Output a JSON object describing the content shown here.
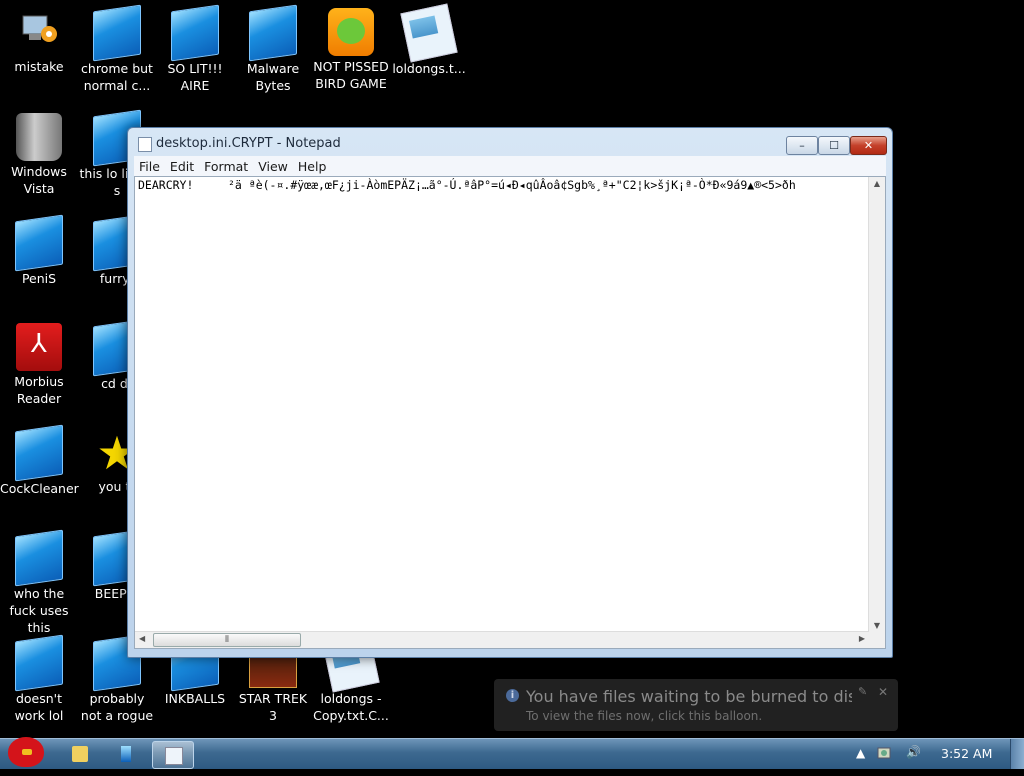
{
  "desktop": {
    "icons": [
      {
        "label": "mistake"
      },
      {
        "label": "chrome but normal c..."
      },
      {
        "label": "SO LIT!!! AIRE"
      },
      {
        "label": "Malware Bytes"
      },
      {
        "label": "NOT PISSED BIRD GAME"
      },
      {
        "label": "loldongs.t..."
      },
      {
        "label": "Windows Vista"
      },
      {
        "label": "this lo like a s"
      },
      {
        "label": "PeniS"
      },
      {
        "label": "furryf"
      },
      {
        "label": "Morbius Reader"
      },
      {
        "label": "cd dr"
      },
      {
        "label": "CockCleaner"
      },
      {
        "label": "you tr"
      },
      {
        "label": "who the fuck uses this"
      },
      {
        "label": "BEEP B"
      },
      {
        "label": "doesn't work lol"
      },
      {
        "label": "probably not a rogue"
      },
      {
        "label": "INKBALLS"
      },
      {
        "label": "STAR TREK 3"
      },
      {
        "label": "loldongs - Copy.txt.C..."
      }
    ]
  },
  "notepad": {
    "title": "desktop.ini.CRYPT - Notepad",
    "menu": [
      "File",
      "Edit",
      "Format",
      "View",
      "Help"
    ],
    "content": "DEARCRY!     ²ä ªè(-¤.#ÿœæ,œF¿ji-ÀòmEPÄZ¡…ã°-Ú.ªâP°=ú◂Đ◂qûÂoâ¢Sgb%¸ª+\"C2¦k>šjK¡ª-Ò*Ð«9á9▲®<5>ðh",
    "scroll_thumb": "⦀",
    "buttons": {
      "minimize": "–",
      "maximize": "☐",
      "close": "✕"
    }
  },
  "balloon": {
    "title": "You have files waiting to be burned to disc",
    "text": "To view the files now, click this balloon.",
    "info_glyph": "i",
    "close_glyph": "✕",
    "pin_glyph": "✎"
  },
  "taskbar": {
    "clock": "3:52 AM",
    "tray_expand": "▲",
    "volume_glyph": "🔊"
  }
}
